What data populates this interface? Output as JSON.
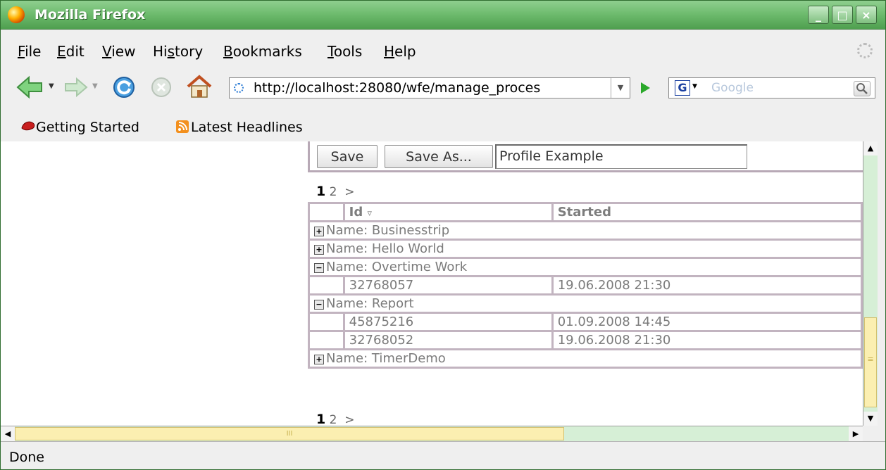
{
  "window": {
    "title": "Mozilla Firefox",
    "controls": [
      "_",
      "□",
      "×"
    ]
  },
  "menu": {
    "items": [
      {
        "pre": "",
        "key": "F",
        "post": "ile"
      },
      {
        "pre": "",
        "key": "E",
        "post": "dit"
      },
      {
        "pre": "",
        "key": "V",
        "post": "iew"
      },
      {
        "pre": "Hi",
        "key": "s",
        "post": "tory"
      },
      {
        "pre": "",
        "key": "B",
        "post": "ookmarks"
      },
      {
        "pre": "",
        "key": "T",
        "post": "ools"
      },
      {
        "pre": "",
        "key": "H",
        "post": "elp"
      }
    ]
  },
  "navigation": {
    "url": "http://localhost:28080/wfe/manage_proces",
    "search_engine": "G",
    "search_placeholder": "Google"
  },
  "bookmarks": {
    "items": [
      "Getting Started",
      "Latest Headlines"
    ]
  },
  "form": {
    "save_label": "Save",
    "save_as_label": "Save As...",
    "profile_value": "Profile Example"
  },
  "pager": {
    "current": "1",
    "next_page": "2",
    "next_arrow": ">"
  },
  "table": {
    "headers": {
      "id": "Id",
      "sort_indicator": "▿",
      "started": "Started"
    },
    "groups": [
      {
        "toggle": "+",
        "label": "Name: Businesstrip",
        "rows": []
      },
      {
        "toggle": "+",
        "label": "Name: Hello World",
        "rows": []
      },
      {
        "toggle": "−",
        "label": "Name: Overtime Work",
        "rows": [
          {
            "id": "32768057",
            "started": "19.06.2008 21:30"
          }
        ]
      },
      {
        "toggle": "−",
        "label": "Name: Report",
        "rows": [
          {
            "id": "45875216",
            "started": "01.09.2008 14:45"
          },
          {
            "id": "32768052",
            "started": "19.06.2008 21:30"
          }
        ]
      },
      {
        "toggle": "+",
        "label": "Name: TimerDemo",
        "rows": []
      }
    ]
  },
  "scrollbars": {
    "grip": "≡",
    "h_grip": "III",
    "up": "▲",
    "down": "▼",
    "left": "◀",
    "right": "▶"
  },
  "status": {
    "text": "Done"
  },
  "colors": {
    "titlebar": "#6cba6c",
    "grid_border": "#c2b4c0",
    "scroll_track": "#d6efd6",
    "scroll_thumb": "#fbefb1"
  }
}
